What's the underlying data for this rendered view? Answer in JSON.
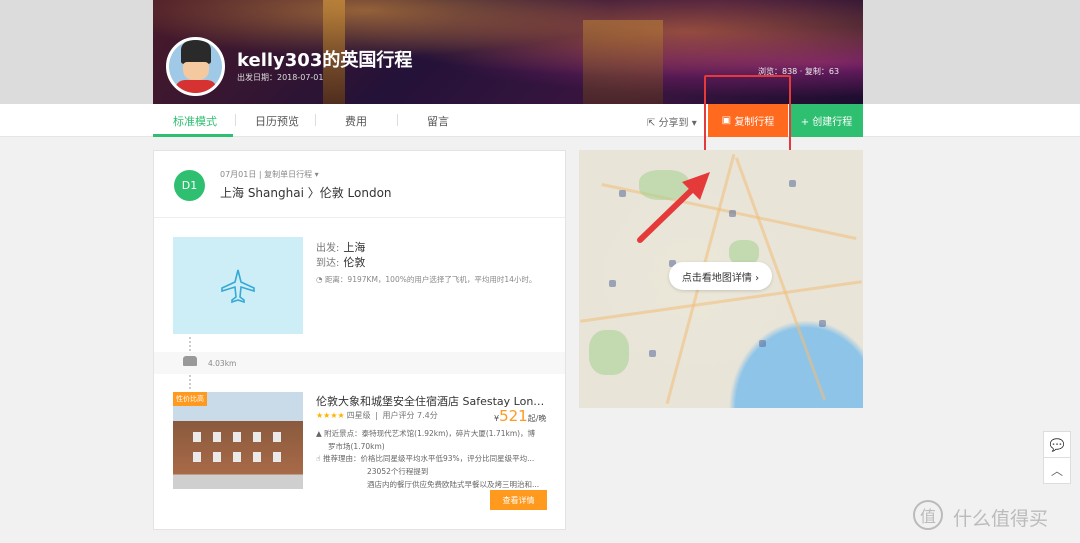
{
  "header": {
    "trip_title": "kelly303的英国行程",
    "depart_date": "出发日期：2018-07-01",
    "stats": "浏览：838 · 复制：63"
  },
  "tabs": [
    "标准模式",
    "日历预览",
    "费用",
    "留言"
  ],
  "actions": {
    "share": "分享到",
    "copy": "复制行程",
    "create": "+ 创建行程"
  },
  "day": {
    "badge": "D1",
    "date": "07月01日",
    "copy_day": "复制单日行程",
    "route": "上海 Shanghai 〉伦敦 London"
  },
  "flight": {
    "from_label": "出发:",
    "from": "上海",
    "to_label": "到达:",
    "to": "伦敦",
    "distance_note": "距离：9197KM，100%的用户选择了飞机，平均用时14小时。"
  },
  "transfer": {
    "distance": "4.03km"
  },
  "hotel": {
    "tag": "性价比高",
    "name": "伦敦大象和城堡安全住宿酒店 Safestay London ...",
    "stars": "★★★★",
    "grade": "四星级",
    "rating": "用户评分 7.4分",
    "currency": "¥",
    "price": "521",
    "unit": "起/晚",
    "nearby": "附近景点：泰特现代艺术馆(1.92km)，碎片大厦(1.71km)，博",
    "nearby2": "罗市场(1.70km)",
    "reason": "推荐理由：价格比同星级平均水平低93%，评分比同星级平均...",
    "reason2": "23052个行程提到",
    "reason3": "酒店内的餐厅供应免费欧陆式早餐以及烤三明治和...",
    "detail_button": "查看详情"
  },
  "map": {
    "button": "点击看地图详情 ›"
  },
  "watermark": {
    "icon": "值",
    "text": "什么值得买"
  }
}
